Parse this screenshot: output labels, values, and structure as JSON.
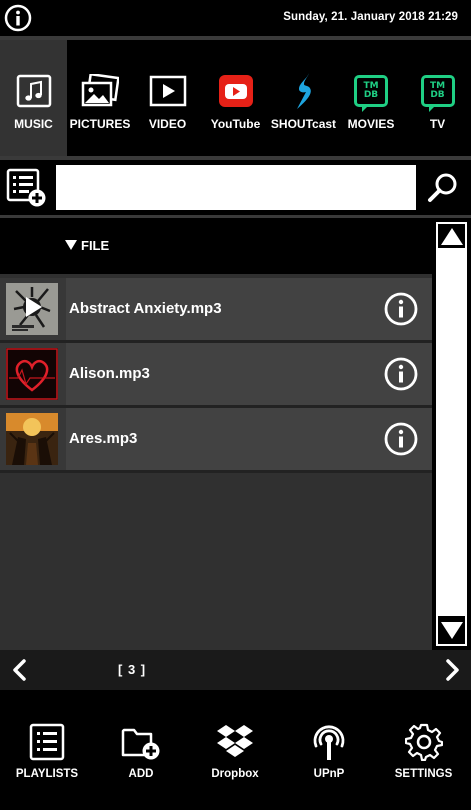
{
  "header": {
    "datetime": "Sunday, 21. January 2018 21:29",
    "info_icon": "info-icon"
  },
  "categories": [
    {
      "label": "MUSIC",
      "icon": "music-note-icon",
      "active": true
    },
    {
      "label": "PICTURES",
      "icon": "pictures-icon",
      "active": false
    },
    {
      "label": "VIDEO",
      "icon": "video-play-icon",
      "active": false
    },
    {
      "label": "YouTube",
      "icon": "youtube-icon",
      "active": false
    },
    {
      "label": "SHOUTcast",
      "icon": "shoutcast-icon",
      "active": false
    },
    {
      "label": "MOVIES",
      "icon": "tmdb-icon",
      "active": false
    },
    {
      "label": "TV",
      "icon": "tmdb-icon",
      "active": false
    }
  ],
  "tmdb": {
    "line1": "TM",
    "line2": "DB"
  },
  "search": {
    "value": "",
    "placeholder": ""
  },
  "list": {
    "sort_label": "FILE",
    "items": [
      {
        "name": "Abstract Anxiety.mp3",
        "playing": true
      },
      {
        "name": "Alison.mp3",
        "playing": false
      },
      {
        "name": "Ares.mp3",
        "playing": false
      }
    ]
  },
  "pager": {
    "page_label": "[ 3 ]"
  },
  "bottom_nav": [
    {
      "label": "PLAYLISTS",
      "icon": "playlist-icon"
    },
    {
      "label": "ADD",
      "icon": "add-folder-icon"
    },
    {
      "label": "Dropbox",
      "icon": "dropbox-icon"
    },
    {
      "label": "UPnP",
      "icon": "upnp-icon"
    },
    {
      "label": "SETTINGS",
      "icon": "gear-icon"
    }
  ],
  "colors": {
    "active_tab": "#333333",
    "youtube_red": "#e62117",
    "shoutcast_blue": "#1ea5e0",
    "tmdb_green": "#1fcf84"
  }
}
